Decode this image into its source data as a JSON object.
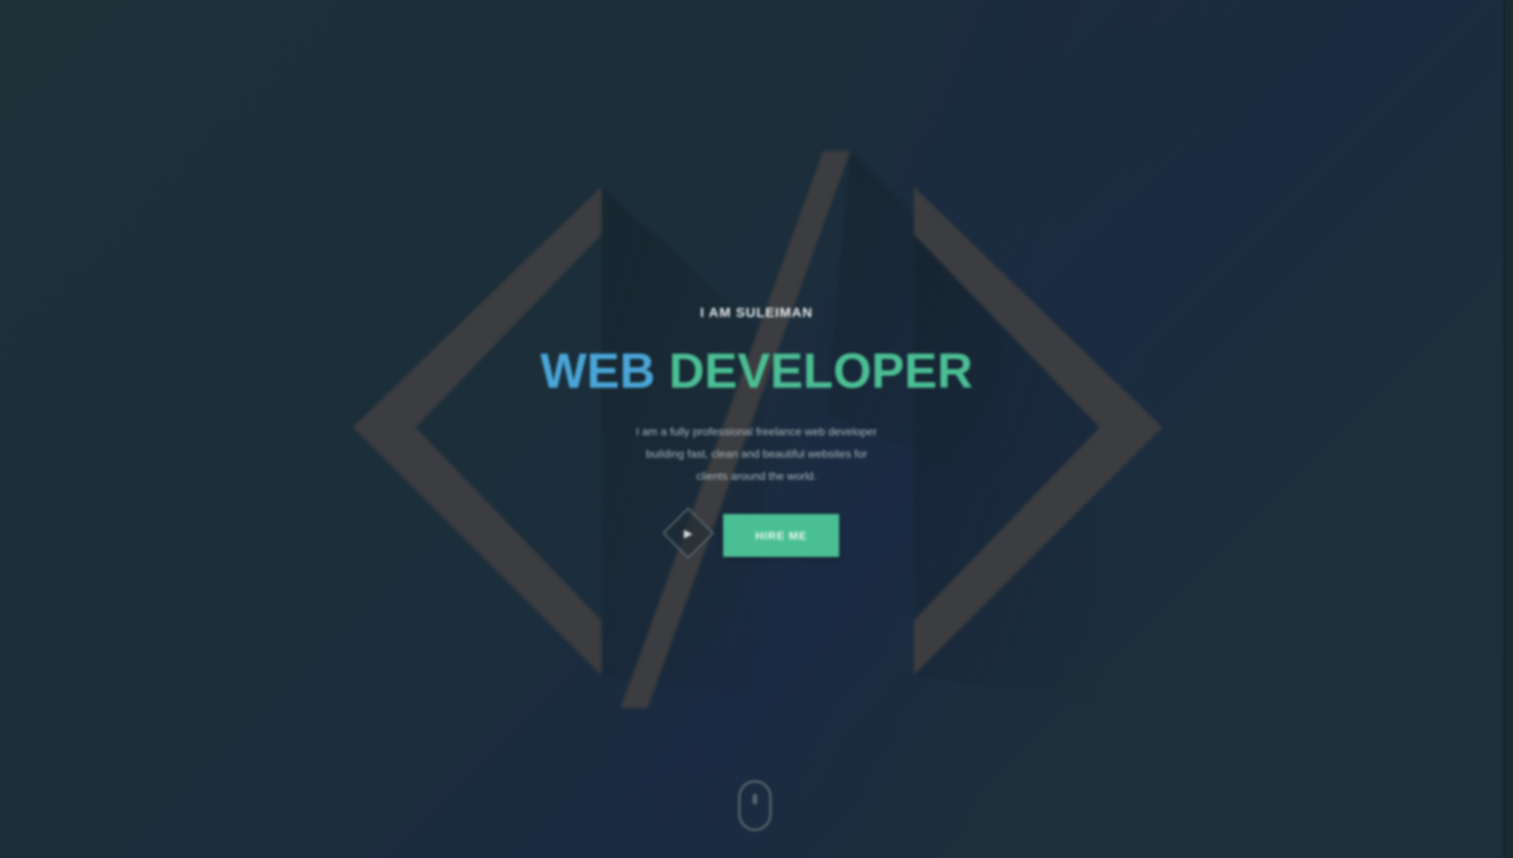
{
  "hero": {
    "kicker": "I AM SULEIMAN",
    "title_part1": "WEB",
    "title_part2": "DEVELOPER",
    "description_line1": "I am a fully professional freelance web developer",
    "description_line2": "building fast, clean and beautiful websites for",
    "description_line3": "clients around the world.",
    "play_icon": "play-icon",
    "play_glyph": "▶",
    "cta_label": "HIRE ME"
  },
  "decoration": {
    "symbol": "</>",
    "symbol_color": "#3c3d40"
  },
  "scroll": {
    "icon": "mouse-scroll-icon"
  },
  "colors": {
    "accent_blue": "#4aa6d8",
    "accent_green": "#4bbf94",
    "background": "#1d2f38"
  }
}
